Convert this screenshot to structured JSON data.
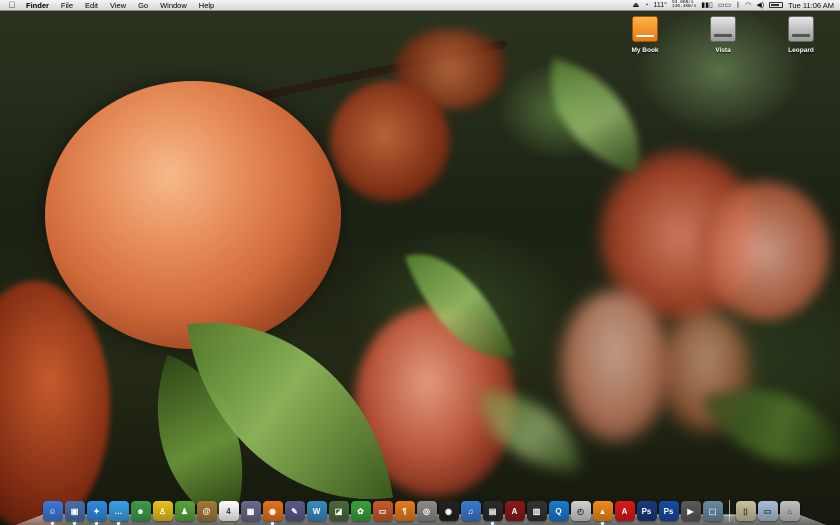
{
  "menubar": {
    "apple": "",
    "app_name": "Finder",
    "items": [
      "File",
      "Edit",
      "View",
      "Go",
      "Window",
      "Help"
    ],
    "temperature": "111°",
    "net_down": "53.8KB/s",
    "net_up": "140.4KB/s",
    "clock": "Tue 11:06 AM"
  },
  "desktop": {
    "icons": [
      {
        "label": "My Book",
        "icon": "external-drive-icon"
      },
      {
        "label": "Vista",
        "icon": "hard-drive-icon"
      },
      {
        "label": "Leopard",
        "icon": "hard-drive-icon"
      }
    ]
  },
  "dock": {
    "apps": [
      {
        "icon": "finder-icon",
        "color": "#3b78d8",
        "glyph": "☺",
        "running": true
      },
      {
        "icon": "preview-icon",
        "color": "#4a6fa8",
        "glyph": "▣",
        "running": true
      },
      {
        "icon": "safari-icon",
        "color": "#2e8be0",
        "glyph": "✦",
        "running": true
      },
      {
        "icon": "ichat-icon",
        "color": "#3aa0e8",
        "glyph": "…",
        "running": true
      },
      {
        "icon": "adium-icon",
        "color": "#3f9c4a",
        "glyph": "☻",
        "running": false
      },
      {
        "icon": "aim-icon",
        "color": "#e8c21a",
        "glyph": "♙",
        "running": false
      },
      {
        "icon": "ichat-buddy-icon",
        "color": "#57a53a",
        "glyph": "♟",
        "running": false
      },
      {
        "icon": "address-book-icon",
        "color": "#a5773a",
        "glyph": "@",
        "running": false
      },
      {
        "icon": "ical-icon",
        "color": "#ffffff",
        "glyph": "4",
        "running": false
      },
      {
        "icon": "photo-booth-icon",
        "color": "#6a6a8a",
        "glyph": "▦",
        "running": false
      },
      {
        "icon": "firefox-icon",
        "color": "#e8721a",
        "glyph": "◉",
        "running": true
      },
      {
        "icon": "script-editor-icon",
        "color": "#5a5a8a",
        "glyph": "✎",
        "running": false
      },
      {
        "icon": "word-icon",
        "color": "#3a8ac0",
        "glyph": "W",
        "running": false
      },
      {
        "icon": "graphic-icon",
        "color": "#4a6a3a",
        "glyph": "◪",
        "running": false
      },
      {
        "icon": "gecko-icon",
        "color": "#3aa03a",
        "glyph": "✿",
        "running": false
      },
      {
        "icon": "keynote-icon",
        "color": "#c85a2a",
        "glyph": "▭",
        "running": false
      },
      {
        "icon": "pages-icon",
        "color": "#e87a1a",
        "glyph": "¶",
        "running": false
      },
      {
        "icon": "screenshot-icon",
        "color": "#8a8a8a",
        "glyph": "◎",
        "running": false
      },
      {
        "icon": "aperture-icon",
        "color": "#222222",
        "glyph": "◉",
        "running": false
      },
      {
        "icon": "itunes-icon",
        "color": "#3a7ad0",
        "glyph": "♫",
        "running": false
      },
      {
        "icon": "activity-monitor-icon",
        "color": "#2a2a2a",
        "glyph": "▤",
        "running": true
      },
      {
        "icon": "dictionary-icon",
        "color": "#8a1a1a",
        "glyph": "A",
        "running": false
      },
      {
        "icon": "stickies-icon",
        "color": "#333333",
        "glyph": "▥",
        "running": false
      },
      {
        "icon": "quicktime-icon",
        "color": "#1a7ad0",
        "glyph": "Q",
        "running": false
      },
      {
        "icon": "alarm-clock-icon",
        "color": "#d0d0d0",
        "glyph": "◴",
        "running": false
      },
      {
        "icon": "vlc-icon",
        "color": "#f08a1a",
        "glyph": "▲",
        "running": true
      },
      {
        "icon": "acrobat-icon",
        "color": "#d81a1a",
        "glyph": "A",
        "running": false
      },
      {
        "icon": "photoshop-icon",
        "color": "#1a3a7a",
        "glyph": "Ps",
        "running": false
      },
      {
        "icon": "photoshop-cs-icon",
        "color": "#1a4aa0",
        "glyph": "Ps",
        "running": false
      },
      {
        "icon": "movie-icon",
        "color": "#5a5a5a",
        "glyph": "▶",
        "running": false
      },
      {
        "icon": "network-icon",
        "color": "#6a8aa0",
        "glyph": "⬚",
        "running": false
      }
    ],
    "right": [
      {
        "icon": "documents-stack-icon",
        "color": "#c8c0a0",
        "glyph": "▯"
      },
      {
        "icon": "folder-icon",
        "color": "#a8c0d8",
        "glyph": "▭"
      },
      {
        "icon": "trash-icon",
        "color": "#c0c0c0",
        "glyph": "⌂"
      }
    ]
  }
}
